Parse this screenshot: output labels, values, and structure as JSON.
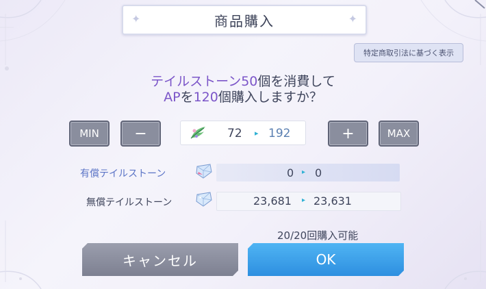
{
  "dialog": {
    "title": "商品購入",
    "legal_button": "特定商取引法に基づく表示",
    "question": {
      "line1_item": "テイルストーン",
      "line1_count": "50",
      "line1_rest": "個を消費して",
      "line2_item": "AP",
      "line2_mid": "を",
      "line2_count": "120",
      "line2_rest": "個購入しますか？"
    },
    "quantity": {
      "min_label": "MIN",
      "minus_label": "−",
      "plus_label": "+",
      "max_label": "MAX",
      "from": "72",
      "arrow": "▸",
      "to": "192",
      "icon": "ap-feather-icon"
    },
    "paid": {
      "label": "有償テイルストーン",
      "from": "0",
      "arrow": "▸",
      "to": "0",
      "icon": "paid-gem-icon"
    },
    "free": {
      "label": "無償テイルストーン",
      "from": "23,681",
      "arrow": "▸",
      "to": "23,631",
      "icon": "free-gem-icon"
    },
    "limit": "20/20回購入可能",
    "cancel_label": "キャンセル",
    "ok_label": "OK"
  },
  "colors": {
    "accent_purple": "#7b55c8",
    "ok_blue": "#3d9fe9",
    "cancel_gray": "#8a8e9e",
    "arrow_cyan": "#2fb1d4"
  }
}
